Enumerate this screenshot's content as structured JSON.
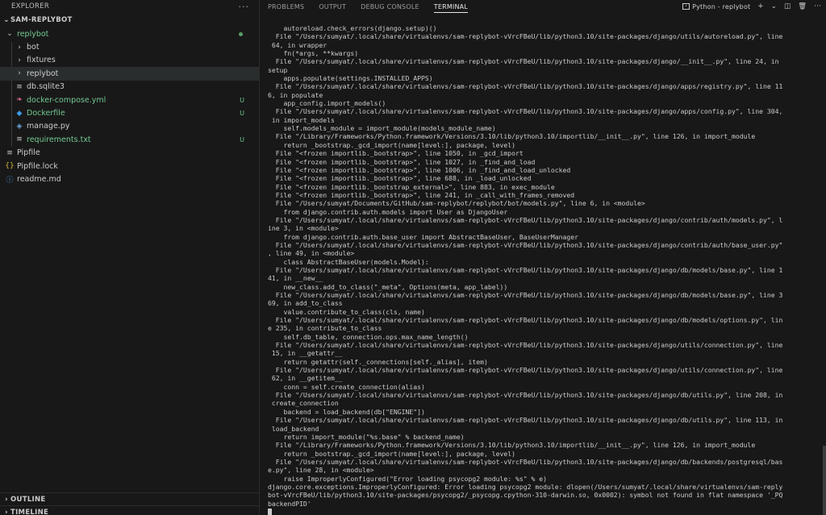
{
  "sidebar": {
    "header": "EXPLORER",
    "more": "···",
    "root": "SAM-REPLYBOT",
    "items": [
      {
        "label": "replybot",
        "chev": "⌄",
        "icon": "",
        "cls": "green",
        "badge": "dot",
        "indent": 6
      },
      {
        "label": "bot",
        "chev": "›",
        "icon": "",
        "cls": "",
        "badge": "",
        "indent": 18
      },
      {
        "label": "fixtures",
        "chev": "›",
        "icon": "",
        "cls": "",
        "badge": "",
        "indent": 18
      },
      {
        "label": "replybot",
        "chev": "›",
        "icon": "",
        "cls": "",
        "badge": "",
        "indent": 18,
        "selected": true
      },
      {
        "label": "db.sqlite3",
        "chev": "",
        "icon": "≡",
        "cls": "",
        "badge": "",
        "indent": 18
      },
      {
        "label": "docker-compose.yml",
        "chev": "",
        "icon": "❧",
        "cls": "green",
        "badge": "U",
        "indent": 18
      },
      {
        "label": "Dockerfile",
        "chev": "",
        "icon": "◆",
        "cls": "green",
        "badge": "U",
        "indent": 18
      },
      {
        "label": "manage.py",
        "chev": "",
        "icon": "◈",
        "cls": "",
        "badge": "",
        "indent": 18
      },
      {
        "label": "requirements.txt",
        "chev": "",
        "icon": "≡",
        "cls": "green",
        "badge": "U",
        "indent": 18
      },
      {
        "label": "Pipfile",
        "chev": "",
        "icon": "≡",
        "cls": "",
        "badge": "",
        "indent": 6
      },
      {
        "label": "Pipfile.lock",
        "chev": "",
        "icon": "{}",
        "cls": "",
        "badge": "",
        "indent": 6
      },
      {
        "label": "readme.md",
        "chev": "",
        "icon": "ⓘ",
        "cls": "",
        "badge": "",
        "indent": 6
      }
    ],
    "outline": "OUTLINE",
    "timeline": "TIMELINE"
  },
  "panel": {
    "tabs": [
      "PROBLEMS",
      "OUTPUT",
      "DEBUG CONSOLE",
      "TERMINAL"
    ],
    "active_tab": 3,
    "terminal_name": "Python - replybot",
    "plus": "+",
    "chevron": "⌄",
    "split": "◫",
    "trash": "🗑",
    "ellipsis": "···"
  },
  "terminal_lines": [
    "    autoreload.check_errors(django.setup)()",
    "  File \"/Users/sumyat/.local/share/virtualenvs/sam-replybot-vVrcFBeU/lib/python3.10/site-packages/django/utils/autoreload.py\", line",
    " 64, in wrapper",
    "    fn(*args, **kwargs)",
    "  File \"/Users/sumyat/.local/share/virtualenvs/sam-replybot-vVrcFBeU/lib/python3.10/site-packages/django/__init__.py\", line 24, in",
    "setup",
    "    apps.populate(settings.INSTALLED_APPS)",
    "  File \"/Users/sumyat/.local/share/virtualenvs/sam-replybot-vVrcFBeU/lib/python3.10/site-packages/django/apps/registry.py\", line 11",
    "6, in populate",
    "    app_config.import_models()",
    "  File \"/Users/sumyat/.local/share/virtualenvs/sam-replybot-vVrcFBeU/lib/python3.10/site-packages/django/apps/config.py\", line 304,",
    " in import_models",
    "    self.models_module = import_module(models_module_name)",
    "  File \"/Library/Frameworks/Python.framework/Versions/3.10/lib/python3.10/importlib/__init__.py\", line 126, in import_module",
    "    return _bootstrap._gcd_import(name[level:], package, level)",
    "  File \"<frozen importlib._bootstrap>\", line 1050, in _gcd_import",
    "  File \"<frozen importlib._bootstrap>\", line 1027, in _find_and_load",
    "  File \"<frozen importlib._bootstrap>\", line 1006, in _find_and_load_unlocked",
    "  File \"<frozen importlib._bootstrap>\", line 688, in _load_unlocked",
    "  File \"<frozen importlib._bootstrap_external>\", line 883, in exec_module",
    "  File \"<frozen importlib._bootstrap>\", line 241, in _call_with_frames_removed",
    "  File \"/Users/sumyat/Documents/GitHub/sam-replybot/replybot/bot/models.py\", line 6, in <module>",
    "    from django.contrib.auth.models import User as DjangoUser",
    "  File \"/Users/sumyat/.local/share/virtualenvs/sam-replybot-vVrcFBeU/lib/python3.10/site-packages/django/contrib/auth/models.py\", l",
    "ine 3, in <module>",
    "    from django.contrib.auth.base_user import AbstractBaseUser, BaseUserManager",
    "  File \"/Users/sumyat/.local/share/virtualenvs/sam-replybot-vVrcFBeU/lib/python3.10/site-packages/django/contrib/auth/base_user.py\"",
    ", line 49, in <module>",
    "    class AbstractBaseUser(models.Model):",
    "  File \"/Users/sumyat/.local/share/virtualenvs/sam-replybot-vVrcFBeU/lib/python3.10/site-packages/django/db/models/base.py\", line 1",
    "41, in __new__",
    "    new_class.add_to_class(\"_meta\", Options(meta, app_label))",
    "  File \"/Users/sumyat/.local/share/virtualenvs/sam-replybot-vVrcFBeU/lib/python3.10/site-packages/django/db/models/base.py\", line 3",
    "69, in add_to_class",
    "    value.contribute_to_class(cls, name)",
    "  File \"/Users/sumyat/.local/share/virtualenvs/sam-replybot-vVrcFBeU/lib/python3.10/site-packages/django/db/models/options.py\", lin",
    "e 235, in contribute_to_class",
    "    self.db_table, connection.ops.max_name_length()",
    "  File \"/Users/sumyat/.local/share/virtualenvs/sam-replybot-vVrcFBeU/lib/python3.10/site-packages/django/utils/connection.py\", line",
    " 15, in __getattr__",
    "    return getattr(self._connections[self._alias], item)",
    "  File \"/Users/sumyat/.local/share/virtualenvs/sam-replybot-vVrcFBeU/lib/python3.10/site-packages/django/utils/connection.py\", line",
    " 62, in __getitem__",
    "    conn = self.create_connection(alias)",
    "  File \"/Users/sumyat/.local/share/virtualenvs/sam-replybot-vVrcFBeU/lib/python3.10/site-packages/django/db/utils.py\", line 208, in",
    " create_connection",
    "    backend = load_backend(db[\"ENGINE\"])",
    "  File \"/Users/sumyat/.local/share/virtualenvs/sam-replybot-vVrcFBeU/lib/python3.10/site-packages/django/db/utils.py\", line 113, in",
    " load_backend",
    "    return import_module(\"%s.base\" % backend_name)",
    "  File \"/Library/Frameworks/Python.framework/Versions/3.10/lib/python3.10/importlib/__init__.py\", line 126, in import_module",
    "    return _bootstrap._gcd_import(name[level:], package, level)",
    "  File \"/Users/sumyat/.local/share/virtualenvs/sam-replybot-vVrcFBeU/lib/python3.10/site-packages/django/db/backends/postgresql/bas",
    "e.py\", line 28, in <module>",
    "    raise ImproperlyConfigured(\"Error loading psycopg2 module: %s\" % e)",
    "django.core.exceptions.ImproperlyConfigured: Error loading psycopg2 module: dlopen(/Users/sumyat/.local/share/virtualenvs/sam-reply",
    "bot-vVrcFBeU/lib/python3.10/site-packages/psycopg2/_psycopg.cpython-310-darwin.so, 0x0002): symbol not found in flat namespace '_PQ",
    "backendPID'"
  ]
}
